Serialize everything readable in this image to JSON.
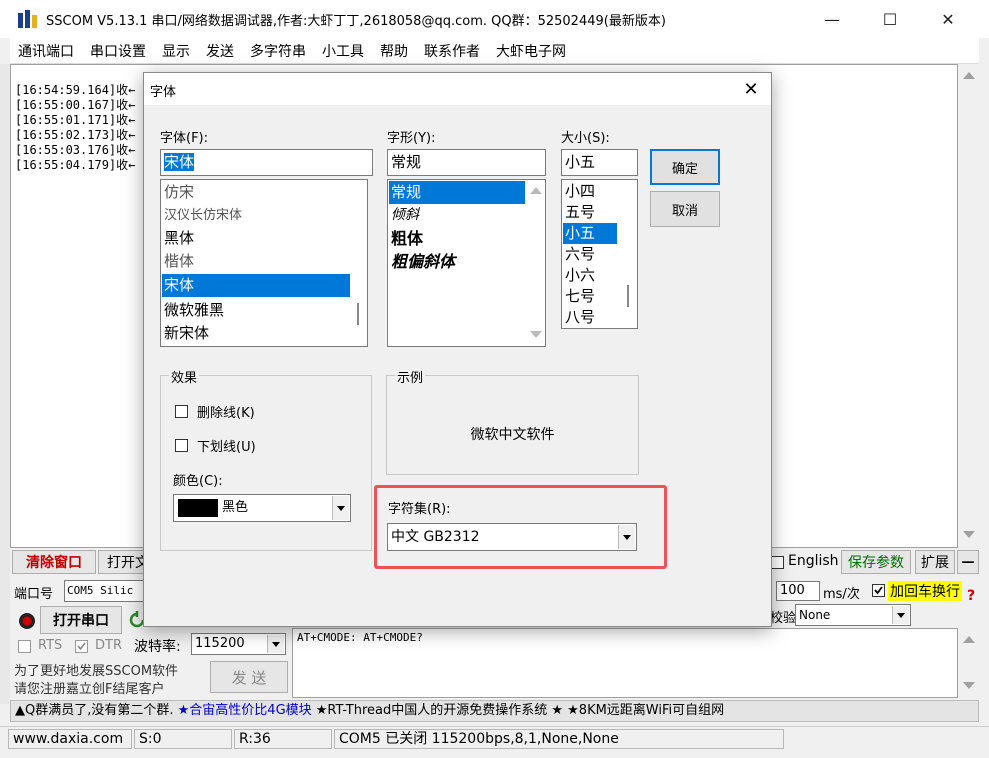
{
  "window": {
    "title": "SSCOM V5.13.1 串口/网络数据调试器,作者:大虾丁丁,2618058@qq.com. QQ群：52502449(最新版本)",
    "minimize": "—",
    "maximize": "☐",
    "close": "✕"
  },
  "menu": [
    "通讯端口",
    "串口设置",
    "显示",
    "发送",
    "多字符串",
    "小工具",
    "帮助",
    "联系作者",
    "大虾电子网"
  ],
  "log": [
    "[16:54:59.164]收←",
    "[16:55:00.167]收←",
    "[16:55:01.171]收←",
    "[16:55:02.173]收←",
    "[16:55:03.176]收←",
    "[16:55:04.179]收←"
  ],
  "controls": {
    "clear_window": "清除窗口",
    "open_file": "打开文",
    "english": "English",
    "save_params": "保存参数",
    "expand": "扩展",
    "dash": "—",
    "port_label": "端口号",
    "port_value": "COM5 Silic",
    "open_port": "打开串口",
    "rts": "RTS",
    "dtr": "DTR",
    "baud_label": "波特率:",
    "baud_value": "115200",
    "interval_value": "100",
    "interval_unit": "ms/次",
    "add_crlf": "加回车换行",
    "checksum_label": "校验",
    "checksum_value": "None",
    "send_text": "AT+CMODE: AT+CMODE?",
    "send_button": "发 送",
    "promo_line1": "为了更好地发展SSCOM软件",
    "promo_line2": "请您注册嘉立创F结尾客户",
    "help_mark": "?"
  },
  "ticker": {
    "part1": "▲Q群满员了,没有第二个群.",
    "part2": "★合宙高性价比4G模块",
    "part3": "★RT-Thread中国人的开源免费操作系统 ★ ★8KM远距离WiFi可自组网"
  },
  "status": {
    "site": "www.daxia.com",
    "sent": "S:0",
    "recv": "R:36",
    "port_state": "COM5 已关闭  115200bps,8,1,None,None"
  },
  "dialog": {
    "title": "字体",
    "close": "✕",
    "font_label": "字体(F):",
    "font_value": "宋体",
    "font_list": [
      "仿宋",
      "汉仪长仿宋体",
      "黑体",
      "楷体",
      "宋体",
      "微软雅黑",
      "新宋体"
    ],
    "style_label": "字形(Y):",
    "style_value": "常规",
    "style_list": [
      "常规",
      "倾斜",
      "粗体",
      "粗偏斜体"
    ],
    "size_label": "大小(S):",
    "size_value": "小五",
    "size_list": [
      "小四",
      "五号",
      "小五",
      "六号",
      "小六",
      "七号",
      "八号"
    ],
    "ok": "确定",
    "cancel": "取消",
    "effects_label": "效果",
    "strikeout": "删除线(K)",
    "underline": "下划线(U)",
    "color_label": "颜色(C):",
    "color_value": "黑色",
    "color_swatch": "#000000",
    "sample_label": "示例",
    "sample_text": "微软中文软件",
    "charset_label": "字符集(R):",
    "charset_value": "中文 GB2312",
    "accent": "#0078d7",
    "highlight_color": "#e85555"
  }
}
